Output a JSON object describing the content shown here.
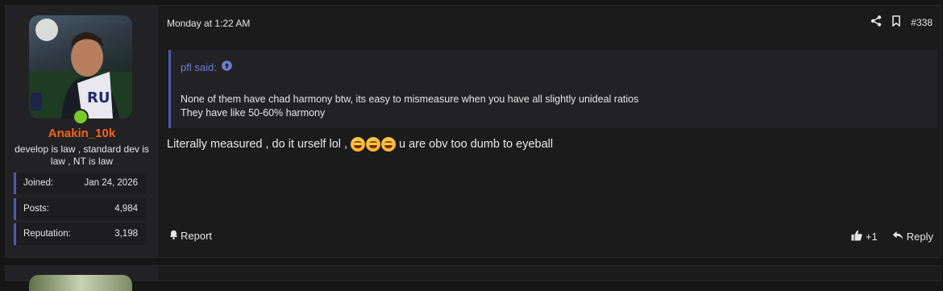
{
  "post": {
    "user": {
      "name": "Anakin_10k",
      "title": "develop is law , standard dev is law , NT is law",
      "online": true,
      "stats": [
        {
          "label": "Joined:",
          "value": "Jan 24, 2026"
        },
        {
          "label": "Posts:",
          "value": "4,984"
        },
        {
          "label": "Reputation:",
          "value": "3,198"
        }
      ]
    },
    "date": "Monday at 1:22 AM",
    "number": "#338",
    "quote": {
      "author": "pfl said:",
      "lines": [
        "None of them have chad harmony btw, its easy to mismeasure when you have all slightly unideal ratios",
        "They have like 50-60% harmony"
      ]
    },
    "message_before": "Literally measured , do it urself lol ,",
    "emojis": [
      "face-with-tears-of-joy",
      "face-with-tears-of-joy",
      "face-with-tears-of-joy"
    ],
    "message_after": "u are obv too dumb to eyeball",
    "report_label": "Report",
    "reaction_count": "+1",
    "reply_label": "Reply"
  },
  "colors": {
    "accent": "#4d5bb0",
    "username": "#f26322",
    "online": "#7ac92a",
    "quote_author": "#6c7ed6"
  }
}
